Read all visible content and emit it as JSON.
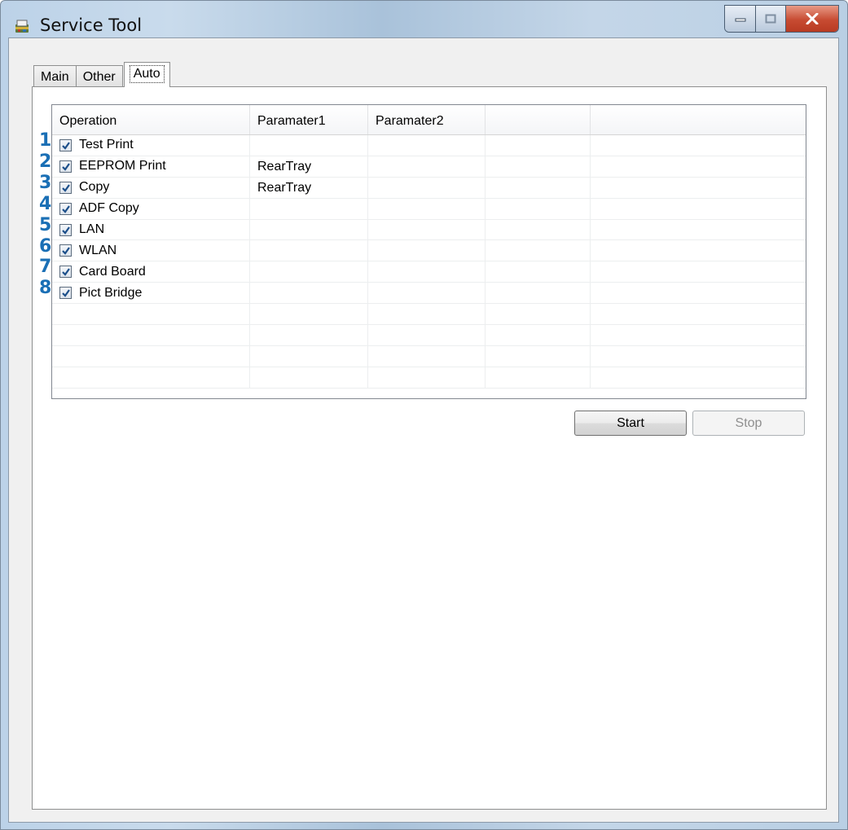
{
  "window": {
    "title": "Service Tool"
  },
  "tabs": [
    {
      "label": "Main",
      "active": false
    },
    {
      "label": "Other",
      "active": false
    },
    {
      "label": "Auto",
      "active": true
    }
  ],
  "list": {
    "columns": [
      "Operation",
      "Paramater1",
      "Paramater2",
      "",
      ""
    ],
    "rows": [
      {
        "num": "1",
        "checked": true,
        "operation": "Test Print",
        "param1": "",
        "param2": ""
      },
      {
        "num": "2",
        "checked": true,
        "operation": "EEPROM Print",
        "param1": "RearTray",
        "param2": ""
      },
      {
        "num": "3",
        "checked": true,
        "operation": "Copy",
        "param1": "RearTray",
        "param2": ""
      },
      {
        "num": "4",
        "checked": true,
        "operation": "ADF Copy",
        "param1": "",
        "param2": ""
      },
      {
        "num": "5",
        "checked": true,
        "operation": "LAN",
        "param1": "",
        "param2": ""
      },
      {
        "num": "6",
        "checked": true,
        "operation": "WLAN",
        "param1": "",
        "param2": ""
      },
      {
        "num": "7",
        "checked": true,
        "operation": "Card Board",
        "param1": "",
        "param2": ""
      },
      {
        "num": "8",
        "checked": true,
        "operation": "Pict Bridge",
        "param1": "",
        "param2": ""
      }
    ]
  },
  "buttons": {
    "start_label": "Start",
    "stop_label": "Stop",
    "stop_disabled": true
  },
  "colors": {
    "row_number": "#1a6fb5",
    "close_button": "#c74b32"
  }
}
